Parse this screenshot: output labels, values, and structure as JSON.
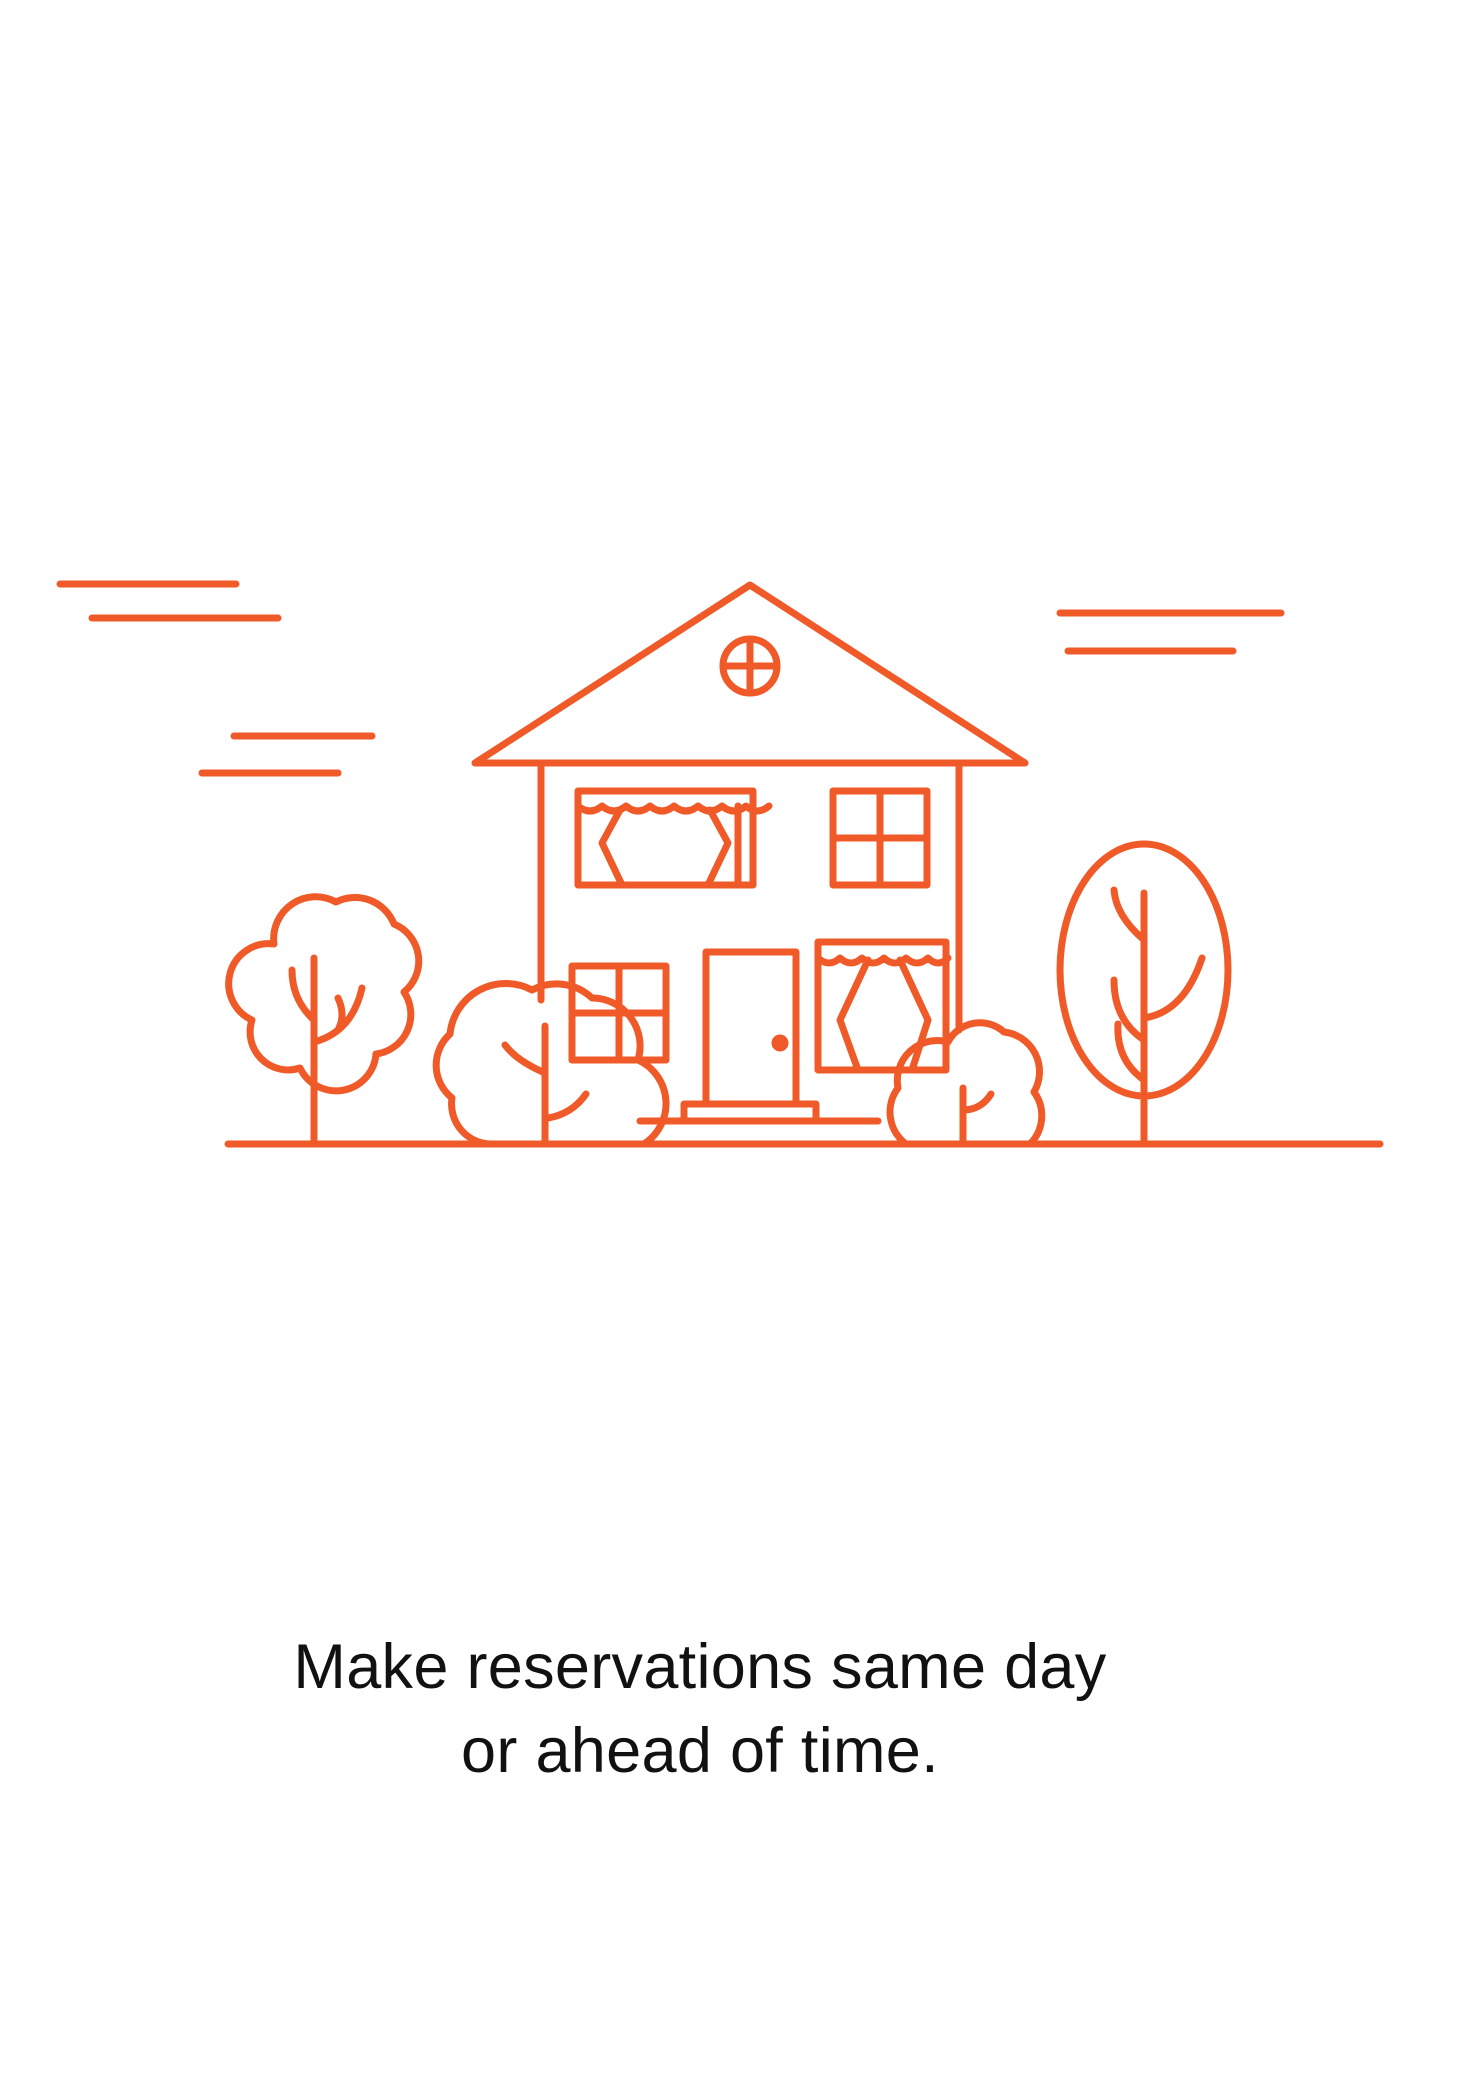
{
  "onboarding": {
    "caption_line_1": "Make reservations same day",
    "caption_line_2": "or ahead of time."
  },
  "theme": {
    "accent": "#F05A28",
    "text": "#111111",
    "background": "#FFFFFF"
  },
  "illustration": {
    "icon": "house-with-trees-icon"
  }
}
